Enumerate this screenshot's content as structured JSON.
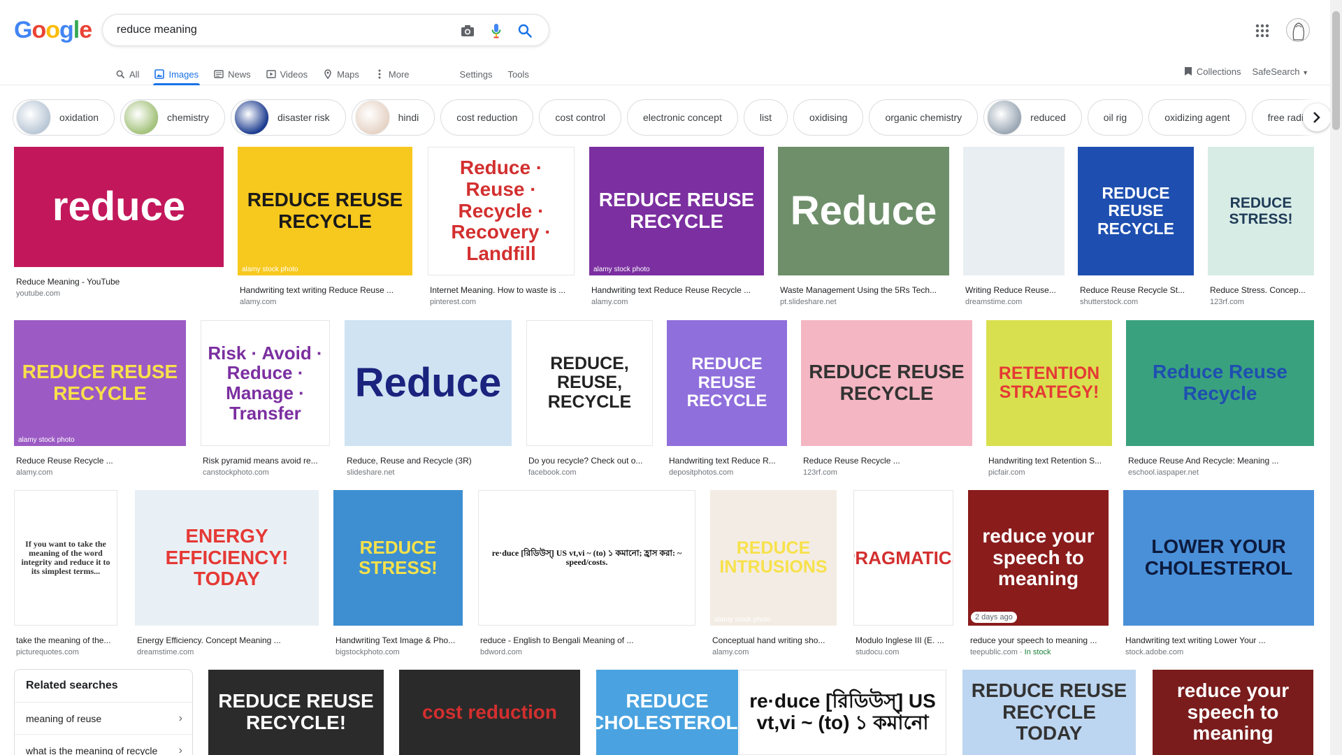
{
  "logo": {
    "letters": [
      "G",
      "o",
      "o",
      "g",
      "l",
      "e"
    ],
    "colors": [
      "#4285f4",
      "#ea4335",
      "#fbbc05",
      "#4285f4",
      "#34a853",
      "#ea4335"
    ]
  },
  "search": {
    "value": "reduce meaning"
  },
  "icons": {
    "camera": "camera-icon",
    "mic": "mic-icon",
    "search": "search-icon",
    "apps": "apps-grid-icon"
  },
  "tabs": [
    {
      "label": "All",
      "icon": "search-icon",
      "active": false
    },
    {
      "label": "Images",
      "icon": "images-icon",
      "active": true
    },
    {
      "label": "News",
      "icon": "news-icon",
      "active": false
    },
    {
      "label": "Videos",
      "icon": "video-icon",
      "active": false
    },
    {
      "label": "Maps",
      "icon": "map-icon",
      "active": false
    },
    {
      "label": "More",
      "icon": "more-icon",
      "active": false
    }
  ],
  "tools": {
    "settings": "Settings",
    "tools": "Tools",
    "collections": "Collections",
    "safesearch": "SafeSearch"
  },
  "chips": [
    {
      "label": "oxidation",
      "thumb": true
    },
    {
      "label": "chemistry",
      "thumb": true
    },
    {
      "label": "disaster risk",
      "thumb": true
    },
    {
      "label": "hindi",
      "thumb": true
    },
    {
      "label": "cost reduction",
      "thumb": false
    },
    {
      "label": "cost control",
      "thumb": false
    },
    {
      "label": "electronic concept",
      "thumb": false
    },
    {
      "label": "list",
      "thumb": false
    },
    {
      "label": "oxidising",
      "thumb": false
    },
    {
      "label": "organic chemistry",
      "thumb": false
    },
    {
      "label": "reduced",
      "thumb": true
    },
    {
      "label": "oil rig",
      "thumb": false
    },
    {
      "label": "oxidizing agent",
      "thumb": false
    },
    {
      "label": "free radical",
      "thumb": false
    }
  ],
  "results": [
    {
      "title": "Reduce Meaning - YouTube",
      "source": "youtube.com",
      "text": "reduce",
      "bg": "#c2185b",
      "fg": "#ffffff"
    },
    {
      "title": "Handwriting text writing Reduce Reuse ...",
      "source": "alamy.com",
      "text": "REDUCE REUSE RECYCLE",
      "bg": "#f7c81e",
      "fg": "#1a1a1a",
      "wm": "alamy stock photo"
    },
    {
      "title": "Internet Meaning. How to waste is ...",
      "source": "pinterest.com",
      "text": "Reduce · Reuse · Recycle · Recovery · Landfill",
      "bg": "#ffffff",
      "fg": "#d32f2f"
    },
    {
      "title": "Handwriting text Reduce Reuse Recycle ...",
      "source": "alamy.com",
      "text": "REDUCE REUSE RECYCLE",
      "bg": "#7b2fa0",
      "fg": "#ffffff",
      "wm": "alamy stock photo"
    },
    {
      "title": "Waste Management Using the 5Rs Tech...",
      "source": "pt.slideshare.net",
      "text": "Reduce",
      "bg": "#6e8f6a",
      "fg": "#ffffff"
    },
    {
      "title": "Writing Reduce Reuse...",
      "source": "dreamstime.com",
      "text": "",
      "bg": "#e8eef2",
      "fg": "#e53935"
    },
    {
      "title": "Reduce Reuse Recycle St...",
      "source": "shutterstock.com",
      "text": "REDUCE REUSE RECYCLE",
      "bg": "#1e4fb0",
      "fg": "#ffffff"
    },
    {
      "title": "Reduce Stress. Concep...",
      "source": "123rf.com",
      "text": "REDUCE STRESS!",
      "bg": "#d8ece6",
      "fg": "#1f3b57"
    },
    {
      "title": "Reduce Reuse Recycle ...",
      "source": "alamy.com",
      "text": "REDUCE REUSE RECYCLE",
      "bg": "#9c5bc4",
      "fg": "#f7e14b",
      "wm": "alamy stock photo"
    },
    {
      "title": "Risk pyramid means avoid re...",
      "source": "canstockphoto.com",
      "text": "Risk · Avoid · Reduce · Manage · Transfer",
      "bg": "#ffffff",
      "fg": "#7b2fa0"
    },
    {
      "title": "Reduce, Reuse and Recycle (3R)",
      "source": "slideshare.net",
      "text": "Reduce",
      "bg": "#cfe3f3",
      "fg": "#1a237e"
    },
    {
      "title": "Do you recycle? Check out o...",
      "source": "facebook.com",
      "text": "REDUCE, REUSE, RECYCLE",
      "bg": "#ffffff",
      "fg": "#222222"
    },
    {
      "title": "Handwriting text Reduce R...",
      "source": "depositphotos.com",
      "text": "REDUCE REUSE RECYCLE",
      "bg": "#8f6fdc",
      "fg": "#ffffff"
    },
    {
      "title": "Reduce Reuse Recycle ...",
      "source": "123rf.com",
      "text": "REDUCE REUSE RECYCLE",
      "bg": "#f4b6c2",
      "fg": "#333333"
    },
    {
      "title": "Handwriting text Retention S...",
      "source": "picfair.com",
      "text": "RETENTION STRATEGY!",
      "bg": "#d9e04f",
      "fg": "#e53935"
    },
    {
      "title": "Reduce Reuse And Recycle: Meaning ...",
      "source": "eschool.iaspaper.net",
      "text": "Reduce Reuse Recycle",
      "bg": "#3aa17e",
      "fg": "#1e4fb0"
    },
    {
      "title": "take the meaning of the...",
      "source": "picturequotes.com",
      "text": "If you want to take the meaning of the word integrity and reduce it to its simplest terms...",
      "bg": "#ffffff",
      "fg": "#333333"
    },
    {
      "title": "Energy Efficiency. Concept Meaning ...",
      "source": "dreamstime.com",
      "text": "ENERGY EFFICIENCY! TODAY",
      "bg": "#e9f0f5",
      "fg": "#e53935"
    },
    {
      "title": "Handwriting Text Image & Pho...",
      "source": "bigstockphoto.com",
      "text": "REDUCE STRESS!",
      "bg": "#3d8fd1",
      "fg": "#f7e14b"
    },
    {
      "title": "reduce - English to Bengali Meaning of ...",
      "source": "bdword.com",
      "text": "re·duce [রিডিউস্‌] US vt,vi ~ (to) ১ কমানো; হ্রাস করা: ~ speed/costs.",
      "bg": "#ffffff",
      "fg": "#111111"
    },
    {
      "title": "Conceptual hand writing sho...",
      "source": "alamy.com",
      "text": "REDUCE INTRUSIONS",
      "bg": "#f3ece4",
      "fg": "#f7e14b",
      "wm": "alamy stock photo"
    },
    {
      "title": "Modulo Inglese III (E. ...",
      "source": "studocu.com",
      "text": "PRAGMATICS",
      "bg": "#ffffff",
      "fg": "#d32f2f"
    },
    {
      "title": "reduce your speech to meaning ...",
      "source": "teepublic.com",
      "stock": "In stock",
      "age": "2 days ago",
      "text": "reduce your speech to meaning",
      "bg": "#8a1c1c",
      "fg": "#ffffff"
    },
    {
      "title": "Handwriting text writing Lower Your ...",
      "source": "stock.adobe.com",
      "text": "LOWER YOUR CHOLESTEROL",
      "bg": "#4a90d9",
      "fg": "#0d1b3d"
    },
    {
      "title": "",
      "source": "",
      "text": "REDUCE REUSE RECYCLE!",
      "bg": "#2b2b2b",
      "fg": "#ffffff"
    },
    {
      "title": "",
      "source": "",
      "text": "cost reduction",
      "bg": "#2a2a2a",
      "fg": "#d32f2f"
    },
    {
      "title": "",
      "source": "",
      "text": "REDUCE CHOLESTEROL!",
      "bg": "#4aa3e0",
      "fg": "#ffffff"
    },
    {
      "title": "",
      "source": "",
      "text": "re·duce [রিডিউস্‌] US vt,vi ~ (to) ১ কমানো",
      "bg": "#ffffff",
      "fg": "#111111"
    },
    {
      "title": "",
      "source": "",
      "text": "REDUCE REUSE RECYCLE TODAY",
      "bg": "#bcd5f0",
      "fg": "#333333"
    },
    {
      "title": "",
      "source": "",
      "text": "reduce your speech to meaning",
      "bg": "#7a1c1c",
      "fg": "#ffffff"
    }
  ],
  "related": {
    "title": "Related searches",
    "items": [
      "meaning of reuse",
      "what is the meaning of recycle"
    ]
  }
}
